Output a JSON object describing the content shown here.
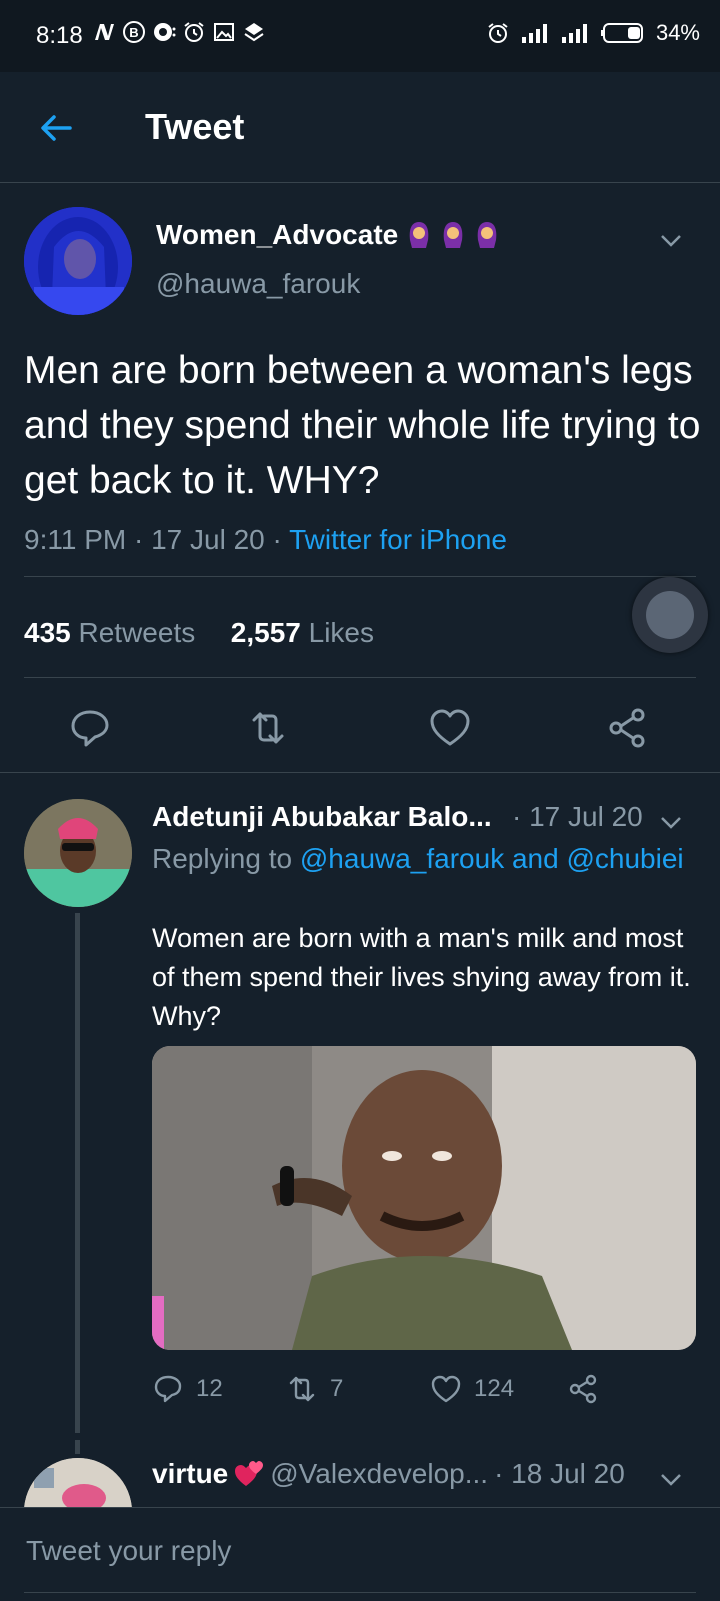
{
  "status_bar": {
    "time": "8:18",
    "battery": "34%",
    "left_icons": [
      "n-icon",
      "b-circle-icon",
      "chat-bubble-icon",
      "alarm-icon",
      "image-icon",
      "layers-icon"
    ],
    "right_icons": [
      "alarm-icon",
      "signal-icon",
      "signal-icon",
      "battery-icon"
    ]
  },
  "header": {
    "title": "Tweet"
  },
  "tweet": {
    "name": "Women_Advocate",
    "name_emoji": "person-with-headscarf-emoji",
    "handle": "@hauwa_farouk",
    "text": "Men are born between a woman's legs and they spend their whole life trying to get back to it. WHY?",
    "time": "9:11 PM",
    "date": "17 Jul 20",
    "source": "Twitter for iPhone",
    "retweets_count": "435",
    "retweets_label": "Retweets",
    "likes_count": "2,557",
    "likes_label": "Likes"
  },
  "replies": [
    {
      "name": "Adetunji Abubakar Balo...",
      "date": "· 17 Jul 20",
      "replying_prefix": "Replying to ",
      "replying_to": "@hauwa_farouk and @chubiei",
      "text": "Women are born with a man's milk and most of them spend their lives shying away from it. Why?",
      "reply_count": "12",
      "retweet_count": "7",
      "like_count": "124"
    },
    {
      "name": "virtue",
      "handle": "@Valexdevelop...",
      "date": "· 18 Jul 20"
    }
  ],
  "compose": {
    "placeholder": "Tweet your reply"
  },
  "colors": {
    "background": "#15202b",
    "accent": "#1da1f2",
    "muted": "#8899a6",
    "divider": "#38444d"
  }
}
